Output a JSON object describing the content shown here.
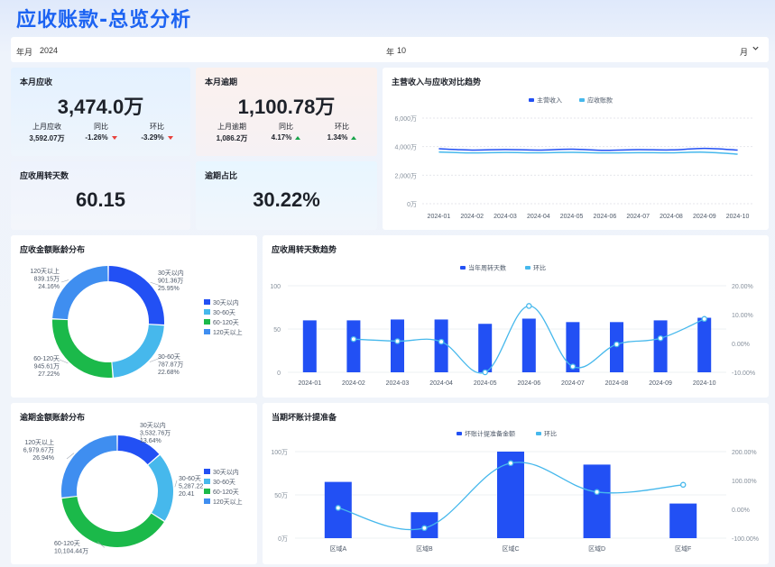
{
  "page": {
    "title": "应收账款-总览分析"
  },
  "filters": {
    "year_label": "年月",
    "year_value": "2024",
    "month_label": "年",
    "month_value": "10",
    "unit_label": "月"
  },
  "kpi": {
    "receivable": {
      "title": "本月应收",
      "value": "3,474.0万",
      "prev_label": "上月应收",
      "prev_value": "3,592.07万",
      "yoy_label": "同比",
      "yoy_value": "-1.26%",
      "mom_label": "环比",
      "mom_value": "-3.29%"
    },
    "overdue": {
      "title": "本月逾期",
      "value": "1,100.78万",
      "prev_label": "上月逾期",
      "prev_value": "1,086.2万",
      "yoy_label": "同比",
      "yoy_value": "4.17%",
      "mom_label": "环比",
      "mom_value": "1.34%"
    },
    "turnover": {
      "title": "应收周转天数",
      "value": "60.15"
    },
    "overdue_ratio": {
      "title": "逾期占比",
      "value": "30.22%"
    }
  },
  "colors": {
    "blue": "#2250f4",
    "cyan": "#46b8ec",
    "green": "#1bb94a",
    "skyblue": "#3f8ef0",
    "primary": "#1c63f2"
  },
  "charts": {
    "trend": {
      "title": "主营收入与应收对比趋势",
      "legend": [
        "主营收入",
        "应收账款"
      ],
      "chart_data": {
        "type": "line",
        "x": [
          "2024-01",
          "2024-02",
          "2024-03",
          "2024-04",
          "2024-05",
          "2024-06",
          "2024-07",
          "2024-08",
          "2024-09",
          "2024-10"
        ],
        "y_ticks": [
          "6,000万",
          "4,000万",
          "2,000万",
          "0万"
        ],
        "ylim": [
          0,
          6000
        ],
        "series": [
          {
            "name": "主营收入",
            "values": [
              3850,
              3760,
              3800,
              3760,
              3820,
              3740,
              3790,
              3770,
              3880,
              3760
            ]
          },
          {
            "name": "应收账款",
            "values": [
              3620,
              3560,
              3590,
              3570,
              3600,
              3560,
              3580,
              3570,
              3610,
              3474
            ]
          }
        ]
      }
    },
    "aging": {
      "title": "应收金额账龄分布",
      "chart_data": {
        "type": "pie",
        "labels": [
          "30天以内",
          "30-60天",
          "60-120天",
          "120天以上"
        ],
        "values": [
          901.36,
          787.87,
          945.61,
          839.15
        ],
        "percents": [
          "25.95%",
          "22.68%",
          "27.22%",
          "24.16%"
        ],
        "value_labels": [
          "901.36万",
          "787.87万",
          "945.61万",
          "839.15万"
        ]
      }
    },
    "turnover_trend": {
      "title": "应收周转天数趋势",
      "legend": [
        "当年周转天数",
        "环比"
      ],
      "chart_data": {
        "type": "bar",
        "categories": [
          "2024-01",
          "2024-02",
          "2024-03",
          "2024-04",
          "2024-05",
          "2024-06",
          "2024-07",
          "2024-08",
          "2024-09",
          "2024-10"
        ],
        "y_ticks": [
          "100",
          "50",
          "0"
        ],
        "y2_ticks": [
          "20.00%",
          "10.00%",
          "0.00%",
          "-10.00%"
        ],
        "ylim": [
          0,
          100
        ],
        "y2lim": [
          -10,
          20
        ],
        "series": [
          {
            "name": "当年周转天数",
            "values": [
              60,
              60,
              61,
              61,
              56,
              62,
              58,
              58,
              60,
              63
            ]
          },
          {
            "name": "环比",
            "values": [
              null,
              1.5,
              0.8,
              0.6,
              -10,
              13,
              -8,
              -0.3,
              1.8,
              8.5
            ]
          }
        ]
      }
    },
    "overdue_aging": {
      "title": "逾期金额账龄分布",
      "chart_data": {
        "type": "pie",
        "labels": [
          "30天以内",
          "30-60天",
          "60-120天",
          "120天以上"
        ],
        "values": [
          3532.76,
          5287.22,
          10104.44,
          6979.67
        ],
        "percents": [
          "13.64%",
          "20.41",
          "",
          "26.94%"
        ],
        "value_labels": [
          "3,532.76万",
          "5,287.22",
          "10,104.44万",
          "6,979.67万"
        ]
      }
    },
    "bad_debt": {
      "title": "当期坏账计提准备",
      "legend": [
        "坏账计提准备金额",
        "环比"
      ],
      "chart_data": {
        "type": "bar",
        "categories": [
          "区域A",
          "区域B",
          "区域C",
          "区域D",
          "区域F"
        ],
        "y_ticks": [
          "100万",
          "50万",
          "0万"
        ],
        "y2_ticks": [
          "200.00%",
          "100.00%",
          "0.00%",
          "-100.00%"
        ],
        "ylim": [
          0,
          100
        ],
        "y2lim": [
          -100,
          200
        ],
        "series": [
          {
            "name": "坏账计提准备金额",
            "values": [
              65,
              30,
              100,
              85,
              40
            ]
          },
          {
            "name": "环比",
            "values": [
              5,
              -65,
              160,
              60,
              85
            ]
          }
        ]
      }
    }
  }
}
